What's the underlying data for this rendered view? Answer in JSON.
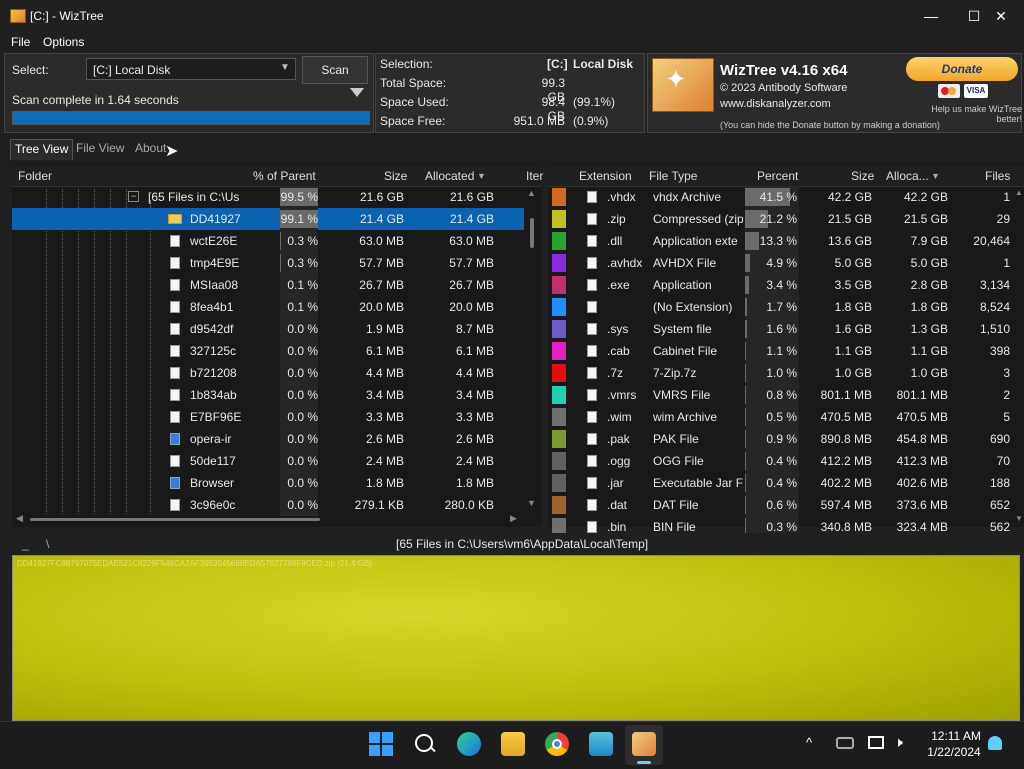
{
  "window": {
    "title": "[C:]  - WizTree",
    "minimize": "—",
    "maximize": "☐",
    "close": "✕"
  },
  "menu": {
    "file": "File",
    "options": "Options"
  },
  "scan": {
    "select_label": "Select:",
    "drive": "[C:] Local Disk",
    "scan_button": "Scan",
    "status": "Scan complete in 1.64 seconds",
    "progress": 1.0
  },
  "info": {
    "selection_label": "Selection:",
    "selection_drive": "[C:]",
    "selection_name": "Local Disk",
    "total_label": "Total Space:",
    "total_value": "99.3 GB",
    "used_label": "Space Used:",
    "used_value": "98.4 GB",
    "used_pct": "(99.1%)",
    "free_label": "Space Free:",
    "free_value": "951.0 MB",
    "free_pct": "(0.9%)"
  },
  "brand": {
    "app_name": "WizTree v4.16 x64",
    "copyright": "© 2023 Antibody Software",
    "website": "www.diskanalyzer.com",
    "hide_note": "(You can hide the Donate button by making a donation)",
    "donate": "Donate",
    "visa": "VISA",
    "donate_note": "Help us make WizTree better!"
  },
  "tabs": [
    "Tree View",
    "File View",
    "About"
  ],
  "tree": {
    "headers": {
      "folder": "Folder",
      "pct": "% of Parent",
      "size": "Size",
      "allocated": "Allocated",
      "items": "Iter"
    },
    "rows": [
      {
        "name": "[65 Files in C:\\Us",
        "pct": "99.5 %",
        "pct_value": 99.5,
        "size": "21.6 GB",
        "allocated": "21.6 GB",
        "icon": "group"
      },
      {
        "name": "DD41927",
        "pct": "99.1 %",
        "pct_value": 99.1,
        "size": "21.4 GB",
        "allocated": "21.4 GB",
        "icon": "folder",
        "selected": true
      },
      {
        "name": "wctE26E",
        "pct": "0.3 %",
        "pct_value": 0.3,
        "size": "63.0 MB",
        "allocated": "63.0 MB",
        "icon": "file"
      },
      {
        "name": "tmp4E9E",
        "pct": "0.3 %",
        "pct_value": 0.3,
        "size": "57.7 MB",
        "allocated": "57.7 MB",
        "icon": "file"
      },
      {
        "name": "MSIaa08",
        "pct": "0.1 %",
        "pct_value": 0.1,
        "size": "26.7 MB",
        "allocated": "26.7 MB",
        "icon": "file"
      },
      {
        "name": "8fea4b1",
        "pct": "0.1 %",
        "pct_value": 0.1,
        "size": "20.0 MB",
        "allocated": "20.0 MB",
        "icon": "file"
      },
      {
        "name": "d9542df",
        "pct": "0.0 %",
        "pct_value": 0.0,
        "size": "1.9 MB",
        "allocated": "8.7 MB",
        "icon": "file"
      },
      {
        "name": "327125c",
        "pct": "0.0 %",
        "pct_value": 0.0,
        "size": "6.1 MB",
        "allocated": "6.1 MB",
        "icon": "file"
      },
      {
        "name": "b721208",
        "pct": "0.0 %",
        "pct_value": 0.0,
        "size": "4.4 MB",
        "allocated": "4.4 MB",
        "icon": "file"
      },
      {
        "name": "1b834ab",
        "pct": "0.0 %",
        "pct_value": 0.0,
        "size": "3.4 MB",
        "allocated": "3.4 MB",
        "icon": "file"
      },
      {
        "name": "E7BF96E",
        "pct": "0.0 %",
        "pct_value": 0.0,
        "size": "3.3 MB",
        "allocated": "3.3 MB",
        "icon": "file"
      },
      {
        "name": "opera-ir",
        "pct": "0.0 %",
        "pct_value": 0.0,
        "size": "2.6 MB",
        "allocated": "2.6 MB",
        "icon": "app"
      },
      {
        "name": "50de117",
        "pct": "0.0 %",
        "pct_value": 0.0,
        "size": "2.4 MB",
        "allocated": "2.4 MB",
        "icon": "file"
      },
      {
        "name": "Browser",
        "pct": "0.0 %",
        "pct_value": 0.0,
        "size": "1.8 MB",
        "allocated": "1.8 MB",
        "icon": "app"
      },
      {
        "name": "3c96e0c",
        "pct": "0.0 %",
        "pct_value": 0.0,
        "size": "279.1 KB",
        "allocated": "280.0 KB",
        "icon": "file"
      }
    ]
  },
  "extensions": {
    "headers": {
      "extension": "Extension",
      "filetype": "File Type",
      "percent": "Percent",
      "size": "Size",
      "allocated": "Alloca...",
      "files": "Files"
    },
    "rows": [
      {
        "color": "#d2691e",
        "ext": ".vhdx",
        "type": "vhdx Archive",
        "pct": "41.5 %",
        "pct_value": 41.5,
        "size": "42.2 GB",
        "allocated": "42.2 GB",
        "files": "1"
      },
      {
        "color": "#c0c020",
        "ext": ".zip",
        "type": "Compressed (zip",
        "pct": "21.2 %",
        "pct_value": 21.2,
        "size": "21.5 GB",
        "allocated": "21.5 GB",
        "files": "29"
      },
      {
        "color": "#2ea02e",
        "ext": ".dll",
        "type": "Application exte",
        "pct": "13.3 %",
        "pct_value": 13.3,
        "size": "13.6 GB",
        "allocated": "7.9 GB",
        "files": "20,464"
      },
      {
        "color": "#8a2be2",
        "ext": ".avhdx",
        "type": "AVHDX File",
        "pct": "4.9 %",
        "pct_value": 4.9,
        "size": "5.0 GB",
        "allocated": "5.0 GB",
        "files": "1"
      },
      {
        "color": "#c0306a",
        "ext": ".exe",
        "type": "Application",
        "pct": "3.4 %",
        "pct_value": 3.4,
        "size": "3.5 GB",
        "allocated": "2.8 GB",
        "files": "3,134"
      },
      {
        "color": "#1e90ff",
        "ext": "",
        "type": "(No Extension)",
        "pct": "1.7 %",
        "pct_value": 1.7,
        "size": "1.8 GB",
        "allocated": "1.8 GB",
        "files": "8,524"
      },
      {
        "color": "#6a5acd",
        "ext": ".sys",
        "type": "System file",
        "pct": "1.6 %",
        "pct_value": 1.6,
        "size": "1.6 GB",
        "allocated": "1.3 GB",
        "files": "1,510"
      },
      {
        "color": "#e020c0",
        "ext": ".cab",
        "type": "Cabinet File",
        "pct": "1.1 %",
        "pct_value": 1.1,
        "size": "1.1 GB",
        "allocated": "1.1 GB",
        "files": "398"
      },
      {
        "color": "#e01010",
        "ext": ".7z",
        "type": "7-Zip.7z",
        "pct": "1.0 %",
        "pct_value": 1.0,
        "size": "1.0 GB",
        "allocated": "1.0 GB",
        "files": "3"
      },
      {
        "color": "#20d0b0",
        "ext": ".vmrs",
        "type": "VMRS File",
        "pct": "0.8 %",
        "pct_value": 0.8,
        "size": "801.1 MB",
        "allocated": "801.1 MB",
        "files": "2"
      },
      {
        "color": "#707070",
        "ext": ".wim",
        "type": "wim Archive",
        "pct": "0.5 %",
        "pct_value": 0.5,
        "size": "470.5 MB",
        "allocated": "470.5 MB",
        "files": "5"
      },
      {
        "color": "#7a9a30",
        "ext": ".pak",
        "type": "PAK File",
        "pct": "0.9 %",
        "pct_value": 0.9,
        "size": "890.8 MB",
        "allocated": "454.8 MB",
        "files": "690"
      },
      {
        "color": "#606060",
        "ext": ".ogg",
        "type": "OGG File",
        "pct": "0.4 %",
        "pct_value": 0.4,
        "size": "412.2 MB",
        "allocated": "412.3 MB",
        "files": "70"
      },
      {
        "color": "#606060",
        "ext": ".jar",
        "type": "Executable Jar Fi",
        "pct": "0.4 %",
        "pct_value": 0.4,
        "size": "402.2 MB",
        "allocated": "402.6 MB",
        "files": "188"
      },
      {
        "color": "#a0622d",
        "ext": ".dat",
        "type": "DAT File",
        "pct": "0.6 %",
        "pct_value": 0.6,
        "size": "597.4 MB",
        "allocated": "373.6 MB",
        "files": "652"
      },
      {
        "color": "#707070",
        "ext": ".bin",
        "type": "BIN File",
        "pct": "0.3 %",
        "pct_value": 0.3,
        "size": "340.8 MB",
        "allocated": "323.4 MB",
        "files": "562"
      }
    ]
  },
  "path_bar": {
    "path": "[65 Files in C:\\Users\\vm6\\AppData\\Local\\Temp]"
  },
  "treemap": {
    "label": "DD41927FC98797075EDAE521C8229F546CA2AF3953545688EDA57927789F9CED.zip (21.4 GB)",
    "color": "#c4c617"
  },
  "taskbar": {
    "time": "12:11 AM",
    "date": "1/22/2024",
    "icons": [
      "start-icon",
      "search-icon",
      "edge-icon",
      "file-explorer-icon",
      "chrome-icon",
      "app-icon",
      "wiztree-icon"
    ]
  }
}
